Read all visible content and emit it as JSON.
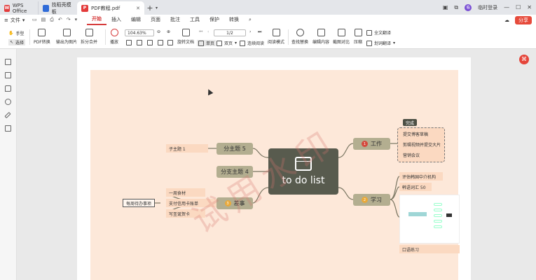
{
  "tabs": {
    "app_label": "WPS Office",
    "tab1_label": "找稻壳模板",
    "tab2_label": "PDF教程.pdf",
    "tab2_badge": "P"
  },
  "window": {
    "login_label": "临时登录",
    "avatar_text": "临"
  },
  "menu": {
    "file_label": "文件",
    "items": [
      "开始",
      "插入",
      "编辑",
      "页面",
      "批注",
      "工具",
      "保护",
      "转换"
    ],
    "share_label": "分享"
  },
  "toolbar": {
    "hand_label": "手型",
    "select_label": "选择",
    "pdf_convert": "PDF转换",
    "export_image": "输出为图片",
    "split_merge": "拆分合并",
    "play": "播放",
    "zoom_value": "104.63%",
    "page_value": "1/2",
    "rotate_doc": "旋转文档",
    "single_page": "单页",
    "double_page": "双页",
    "continuous": "连续阅读",
    "read_mode": "阅读模式",
    "find_replace": "查找替换",
    "edit_content": "编辑内容",
    "screenshot_compare": "截图对比",
    "compress": "压缩",
    "full_translate": "全文翻译",
    "word_translate": "划词翻译"
  },
  "mindmap": {
    "center": "to do list",
    "work": "工作",
    "work_marker": "1",
    "done_tag": "完成",
    "work_items": [
      "提交博客草稿",
      "剪辑视频并提交大片",
      "营销会议"
    ],
    "study": "学习",
    "study_marker": "2",
    "study_items": [
      "评估韩国中介机构",
      "韩语词汇 50"
    ],
    "study_image_label": "口语练习",
    "chores": "差事",
    "chores_marker": "3",
    "chores_items": [
      "一周食材",
      "支付信用卡账单",
      "写圣诞贺卡"
    ],
    "chores_parent": "每周待办事项",
    "sub5": "分主题 5",
    "sub4": "分支主题 4",
    "child1": "子主题 1",
    "watermark": "试用水印"
  },
  "colors": {
    "accent": "#d63b3b",
    "center_bg": "#585b4e",
    "main_node_bg": "#b3ae90",
    "canvas_bg": "#fde8d9"
  }
}
